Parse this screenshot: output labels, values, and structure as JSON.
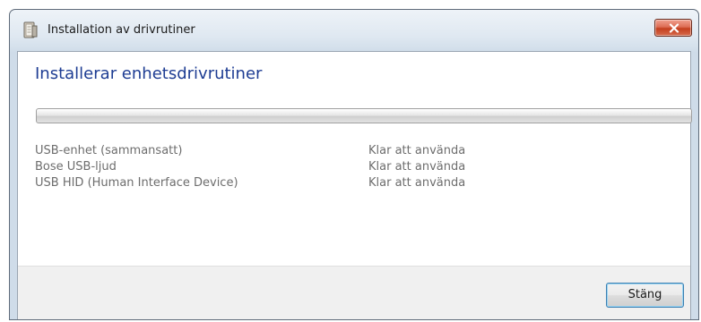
{
  "window": {
    "title": "Installation av drivrutiner",
    "title_icon": "driver-install-icon",
    "close_icon": "close-x-icon"
  },
  "main": {
    "heading": "Installerar enhetsdrivrutiner",
    "progress": 0,
    "devices": [
      {
        "name": "USB-enhet (sammansatt)",
        "status": "Klar att använda"
      },
      {
        "name": "Bose USB-ljud",
        "status": "Klar att använda"
      },
      {
        "name": "USB HID (Human Interface Device)",
        "status": "Klar att använda"
      }
    ]
  },
  "footer": {
    "close_label": "Stäng"
  },
  "colors": {
    "heading": "#1e3d93",
    "muted_text": "#6d6d6d",
    "close_button_red": "#c4401f"
  }
}
